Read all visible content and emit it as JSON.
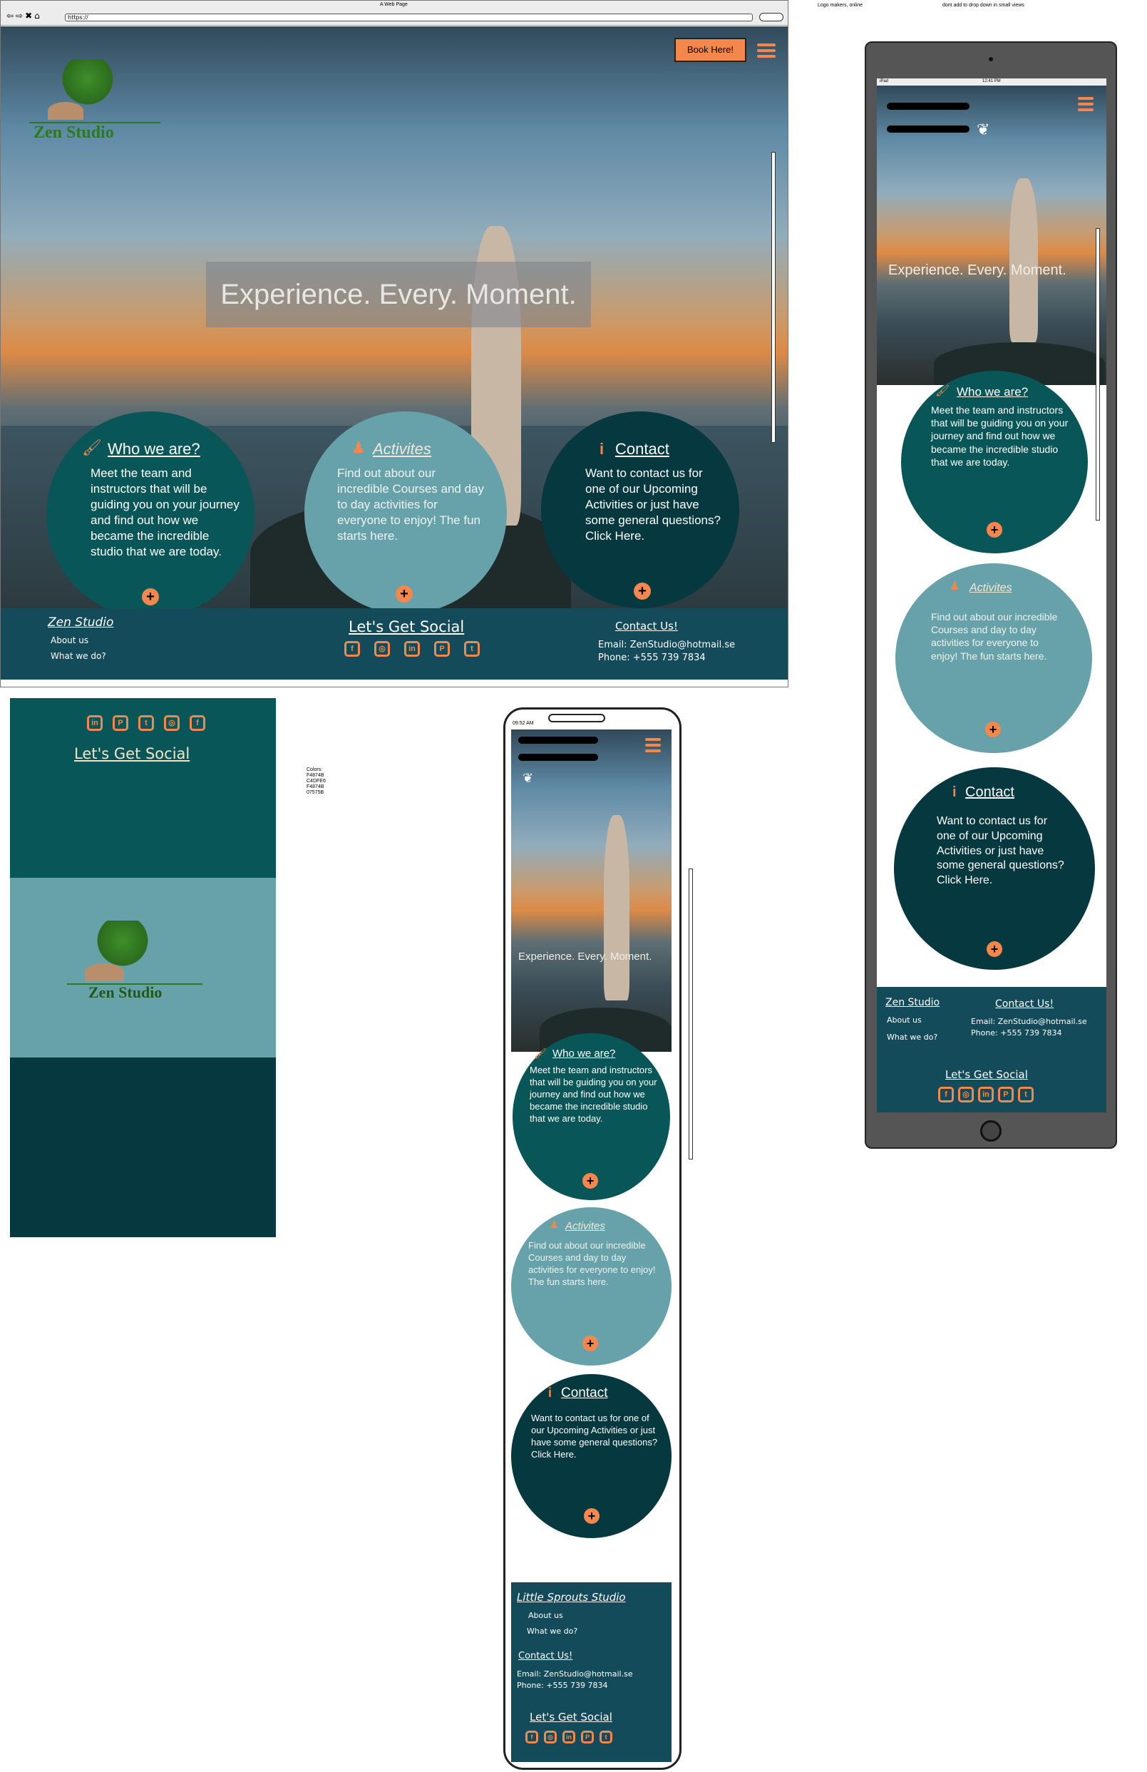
{
  "notes": {
    "logo": "Logo makers, online",
    "dropdown": "dont add to drop down in small views"
  },
  "colors": {
    "label": "Colors:",
    "list": [
      "F4874B",
      "C4DFE6",
      "F4874B",
      "07575B"
    ]
  },
  "desktop": {
    "window_title": "A Web Page",
    "url": "https://",
    "book_button": "Book Here!",
    "logo": "Zen Studio",
    "tagline": "Experience. Every. Moment.",
    "cards": [
      {
        "title": "Who we are?",
        "body": "Meet the team and instructors that will be guiding you on your journey and find out how we became the incredible studio that we are today."
      },
      {
        "title": "Activites",
        "body": "Find out about our incredible Courses and day to day activities for everyone to enjoy! The fun starts here."
      },
      {
        "title": "Contact",
        "body": "Want to contact us for one of our Upcoming Activities or just have some general questions? Click Here."
      }
    ],
    "footer": {
      "brand": "Zen Studio",
      "about": "About us",
      "what": "What we do?",
      "social_title": "Let's Get Social",
      "contact_title": "Contact Us!",
      "email": "Email: ZenStudio@hotmail.se",
      "phone": "Phone: +555 739 7834"
    }
  },
  "social_icons": [
    "facebook-icon",
    "instagram-icon",
    "linkedin-icon",
    "pinterest-icon",
    "twitter-icon"
  ],
  "mobile_panel": {
    "social_title": "Let's Get Social",
    "logo": "Zen Studio"
  },
  "tablet": {
    "status_left": "iPad",
    "status_time": "12:41 PM",
    "tagline": "Experience. Every. Moment.",
    "cards": [
      {
        "title": "Who we are?",
        "body": "Meet the team and instructors that will be guiding you on your journey and find out how we became the incredible studio that we are today."
      },
      {
        "title": "Activites",
        "body": "Find out about our incredible Courses and day to day activities for everyone to enjoy! The fun starts here."
      },
      {
        "title": "Contact",
        "body": "Want to contact us for one of our Upcoming Activities or just have some general questions? Click Here."
      }
    ],
    "footer": {
      "brand": "Zen Studio",
      "about": "About us",
      "what": "What we do?",
      "contact_title": "Contact Us!",
      "email": "Email: ZenStudio@hotmail.se",
      "phone": "Phone: +555 739 7834",
      "social_title": "Let's Get Social"
    }
  },
  "phone": {
    "status_time": "09:52 AM",
    "tagline": "Experience. Every. Moment.",
    "cards": [
      {
        "title": "Who we are?",
        "body": "Meet the team and instructors that will be guiding you on your journey and find out how we became the incredible studio that we are today."
      },
      {
        "title": "Activites",
        "body": "Find out about our incredible Courses and day to day activities for everyone to enjoy! The fun starts here."
      },
      {
        "title": "Contact",
        "body": "Want to contact us for one of our Upcoming Activities or just have some general questions? Click Here."
      }
    ],
    "footer": {
      "brand": "Little Sprouts Studio",
      "about": "About us",
      "what": "What we do?",
      "contact_title": "Contact Us!",
      "email": "Email: ZenStudio@hotmail.se",
      "phone": "Phone: +555 739 7834",
      "social_title": "Let's Get Social"
    }
  }
}
